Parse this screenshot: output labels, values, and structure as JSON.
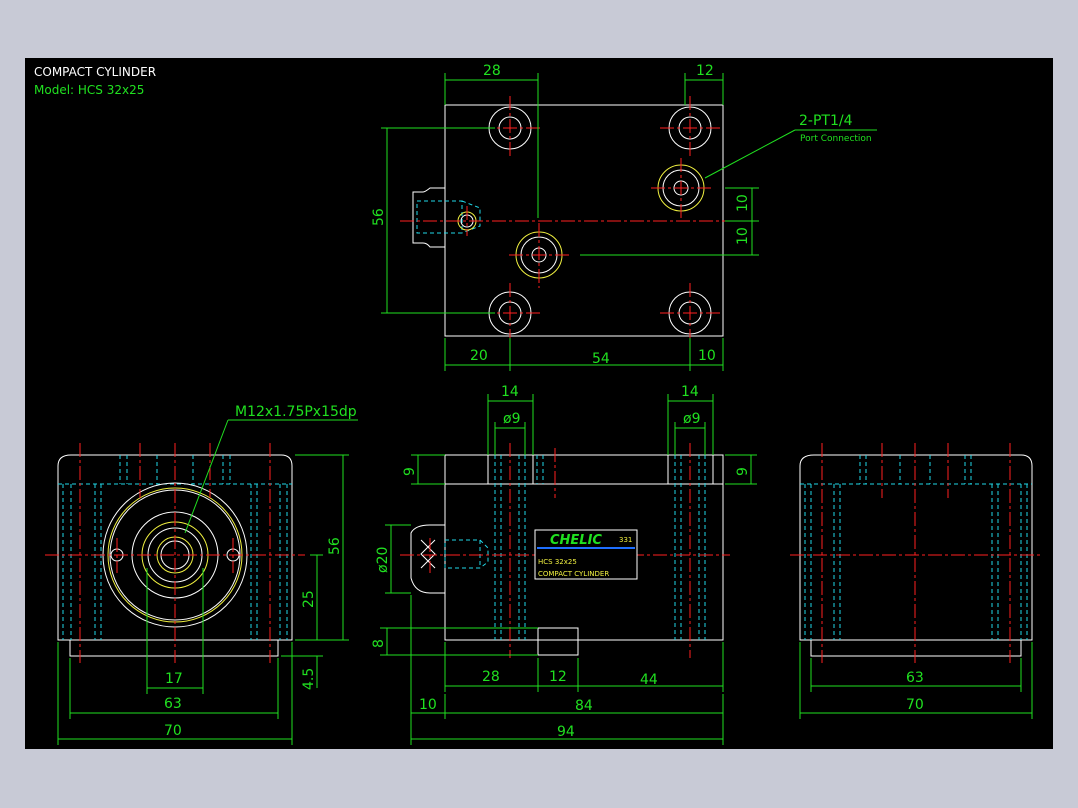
{
  "title_block": {
    "title": "COMPACT CYLINDER",
    "model": "Model: HCS 32x25"
  },
  "callouts": {
    "port_spec": "2-PT1/4",
    "port_note": "Port Connection",
    "thread_spec": "M12x1.75Px15dp"
  },
  "nameplate": {
    "brand": "CHELIC",
    "code": "331",
    "model": "HCS 32x25",
    "desc": "COMPACT CYLINDER"
  },
  "dims": {
    "top_28": "28",
    "top_12": "12",
    "top_56": "56",
    "top_10a": "10",
    "top_10b": "10",
    "top_20": "20",
    "top_54": "54",
    "top_10c": "10",
    "side_14a": "14",
    "side_d9a": "ø9",
    "side_14b": "14",
    "side_d9b": "ø9",
    "side_9a": "9",
    "side_9b": "9",
    "side_d20": "ø20",
    "side_8": "8",
    "side_28": "28",
    "side_12": "12",
    "side_44": "44",
    "side_10": "10",
    "side_84": "84",
    "side_94": "94",
    "front_56": "56",
    "front_25": "25",
    "front_45": "4.5",
    "front_17": "17",
    "front_63": "63",
    "front_70": "70",
    "rear_63": "63",
    "rear_70": "70"
  },
  "colors": {
    "background": "#000000",
    "frame": "#c8cad6",
    "outline": "#ffffff",
    "dimension": "#20e020",
    "centerline": "#ff2020",
    "hidden": "#20d8e8",
    "highlight": "#f0f040"
  }
}
